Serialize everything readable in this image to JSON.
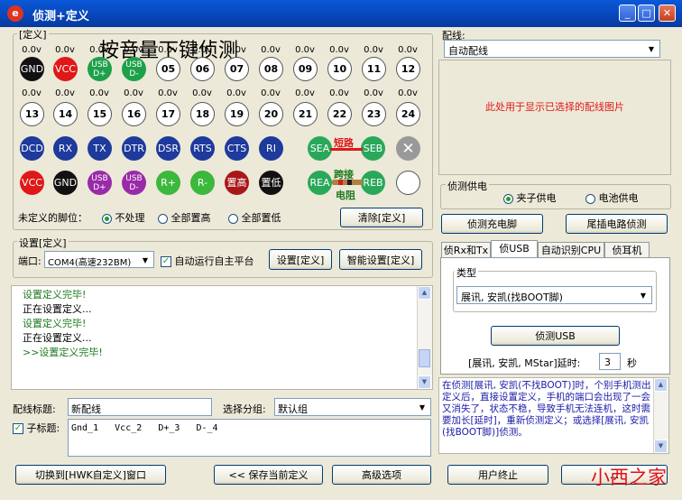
{
  "window": {
    "title": "侦测+定义",
    "buttons": [
      "_",
      "□",
      "✕"
    ]
  },
  "define_group": {
    "title": "[定义]",
    "overlay_hint": "按音量下键侦测",
    "voltage": "0.0v",
    "row1": [
      "GND",
      "VCC",
      "USB D+",
      "USB D-",
      "05",
      "06",
      "07",
      "08",
      "09",
      "10",
      "11",
      "12"
    ],
    "row2": [
      "13",
      "14",
      "15",
      "16",
      "17",
      "18",
      "19",
      "20",
      "21",
      "22",
      "23",
      "24"
    ],
    "row3": [
      "DCD",
      "RX",
      "TX",
      "DTR",
      "DSR",
      "RTS",
      "CTS",
      "RI",
      "SEA",
      "SEB"
    ],
    "row4": [
      "VCC",
      "GND",
      "USB D+",
      "USB D-",
      "R+",
      "R-",
      "置高",
      "置低",
      "REA",
      "REB"
    ],
    "short_label": "短路",
    "jumper_label_1": "跨接",
    "jumper_label_2": "电阻",
    "undefined_label": "未定义的脚位：",
    "radio_options": [
      "不处理",
      "全部置高",
      "全部置低"
    ],
    "selected_radio": "不处理",
    "clear_button": "清除[定义]"
  },
  "settings_group": {
    "title": "设置[定义]",
    "port_label": "端口:",
    "port_value": "COM4(高速232BM)",
    "auto_run_label": "自动运行自主平台",
    "auto_run_checked": true,
    "set_button": "设置[定义]",
    "smart_button": "智能设置[定义]"
  },
  "log": {
    "lines": [
      {
        "text": "设置定义完毕!",
        "color": "#1e7a1e"
      },
      {
        "text": "正在设置定义...",
        "color": "#000000"
      },
      {
        "text": "设置定义完毕!",
        "color": "#1e7a1e"
      },
      {
        "text": "正在设置定义...",
        "color": "#000000"
      },
      {
        "text": ">>设置定义完毕!",
        "color": "#1e7a1e"
      }
    ]
  },
  "wiring": {
    "title_label": "配线标题:",
    "title_value": "新配线",
    "group_label": "选择分组:",
    "group_value": "默认组",
    "subtitle_label": "子标题:",
    "subtitle_checked": true,
    "subtitle_value": "Gnd_1   Vcc_2   D+_3   D-_4"
  },
  "bottom_buttons": {
    "switch": "切换到[HWK自定义]窗口",
    "save": "<< 保存当前定义",
    "advanced": "高级选项",
    "user_end": "用户终止",
    "last": "..."
  },
  "right_panel": {
    "wiring_label": "配线:",
    "wiring_value": "自动配线",
    "image_placeholder": "此处用于显示已选择的配线图片",
    "power_group_title": "侦测供电",
    "power_options": [
      "夹子供电",
      "电池供电"
    ],
    "power_selected": "夹子供电",
    "detect_charge_button": "侦测充电脚",
    "tail_detect_button": "尾插电路侦测",
    "tabs": [
      "侦Rx和Tx",
      "侦USB",
      "自动识别CPU",
      "侦耳机"
    ],
    "active_tab": "侦USB",
    "type_group_title": "类型",
    "type_value": "展讯, 安凯(找BOOT脚)",
    "detect_usb_button": "侦测USB",
    "delay_label": "[展讯, 安凯, MStar]延时:",
    "delay_value": "3",
    "delay_unit": "秒",
    "info_text": "在侦测[展讯, 安凯(不找BOOT)]时，个别手机测出定义后，直接设置定义，手机的端口会出现了一会又消失了，状态不稳，导致手机无法连机，这时需要加长[延时]，重新侦测定义；或选择[展讯, 安凯(找BOOT脚)]侦测。"
  },
  "watermark": "小西之家",
  "colors": {
    "titlebar": "#0845b8",
    "placeholder_text": "#e01818",
    "info_text": "#1a1aa8",
    "short_bar": "#e01818"
  }
}
